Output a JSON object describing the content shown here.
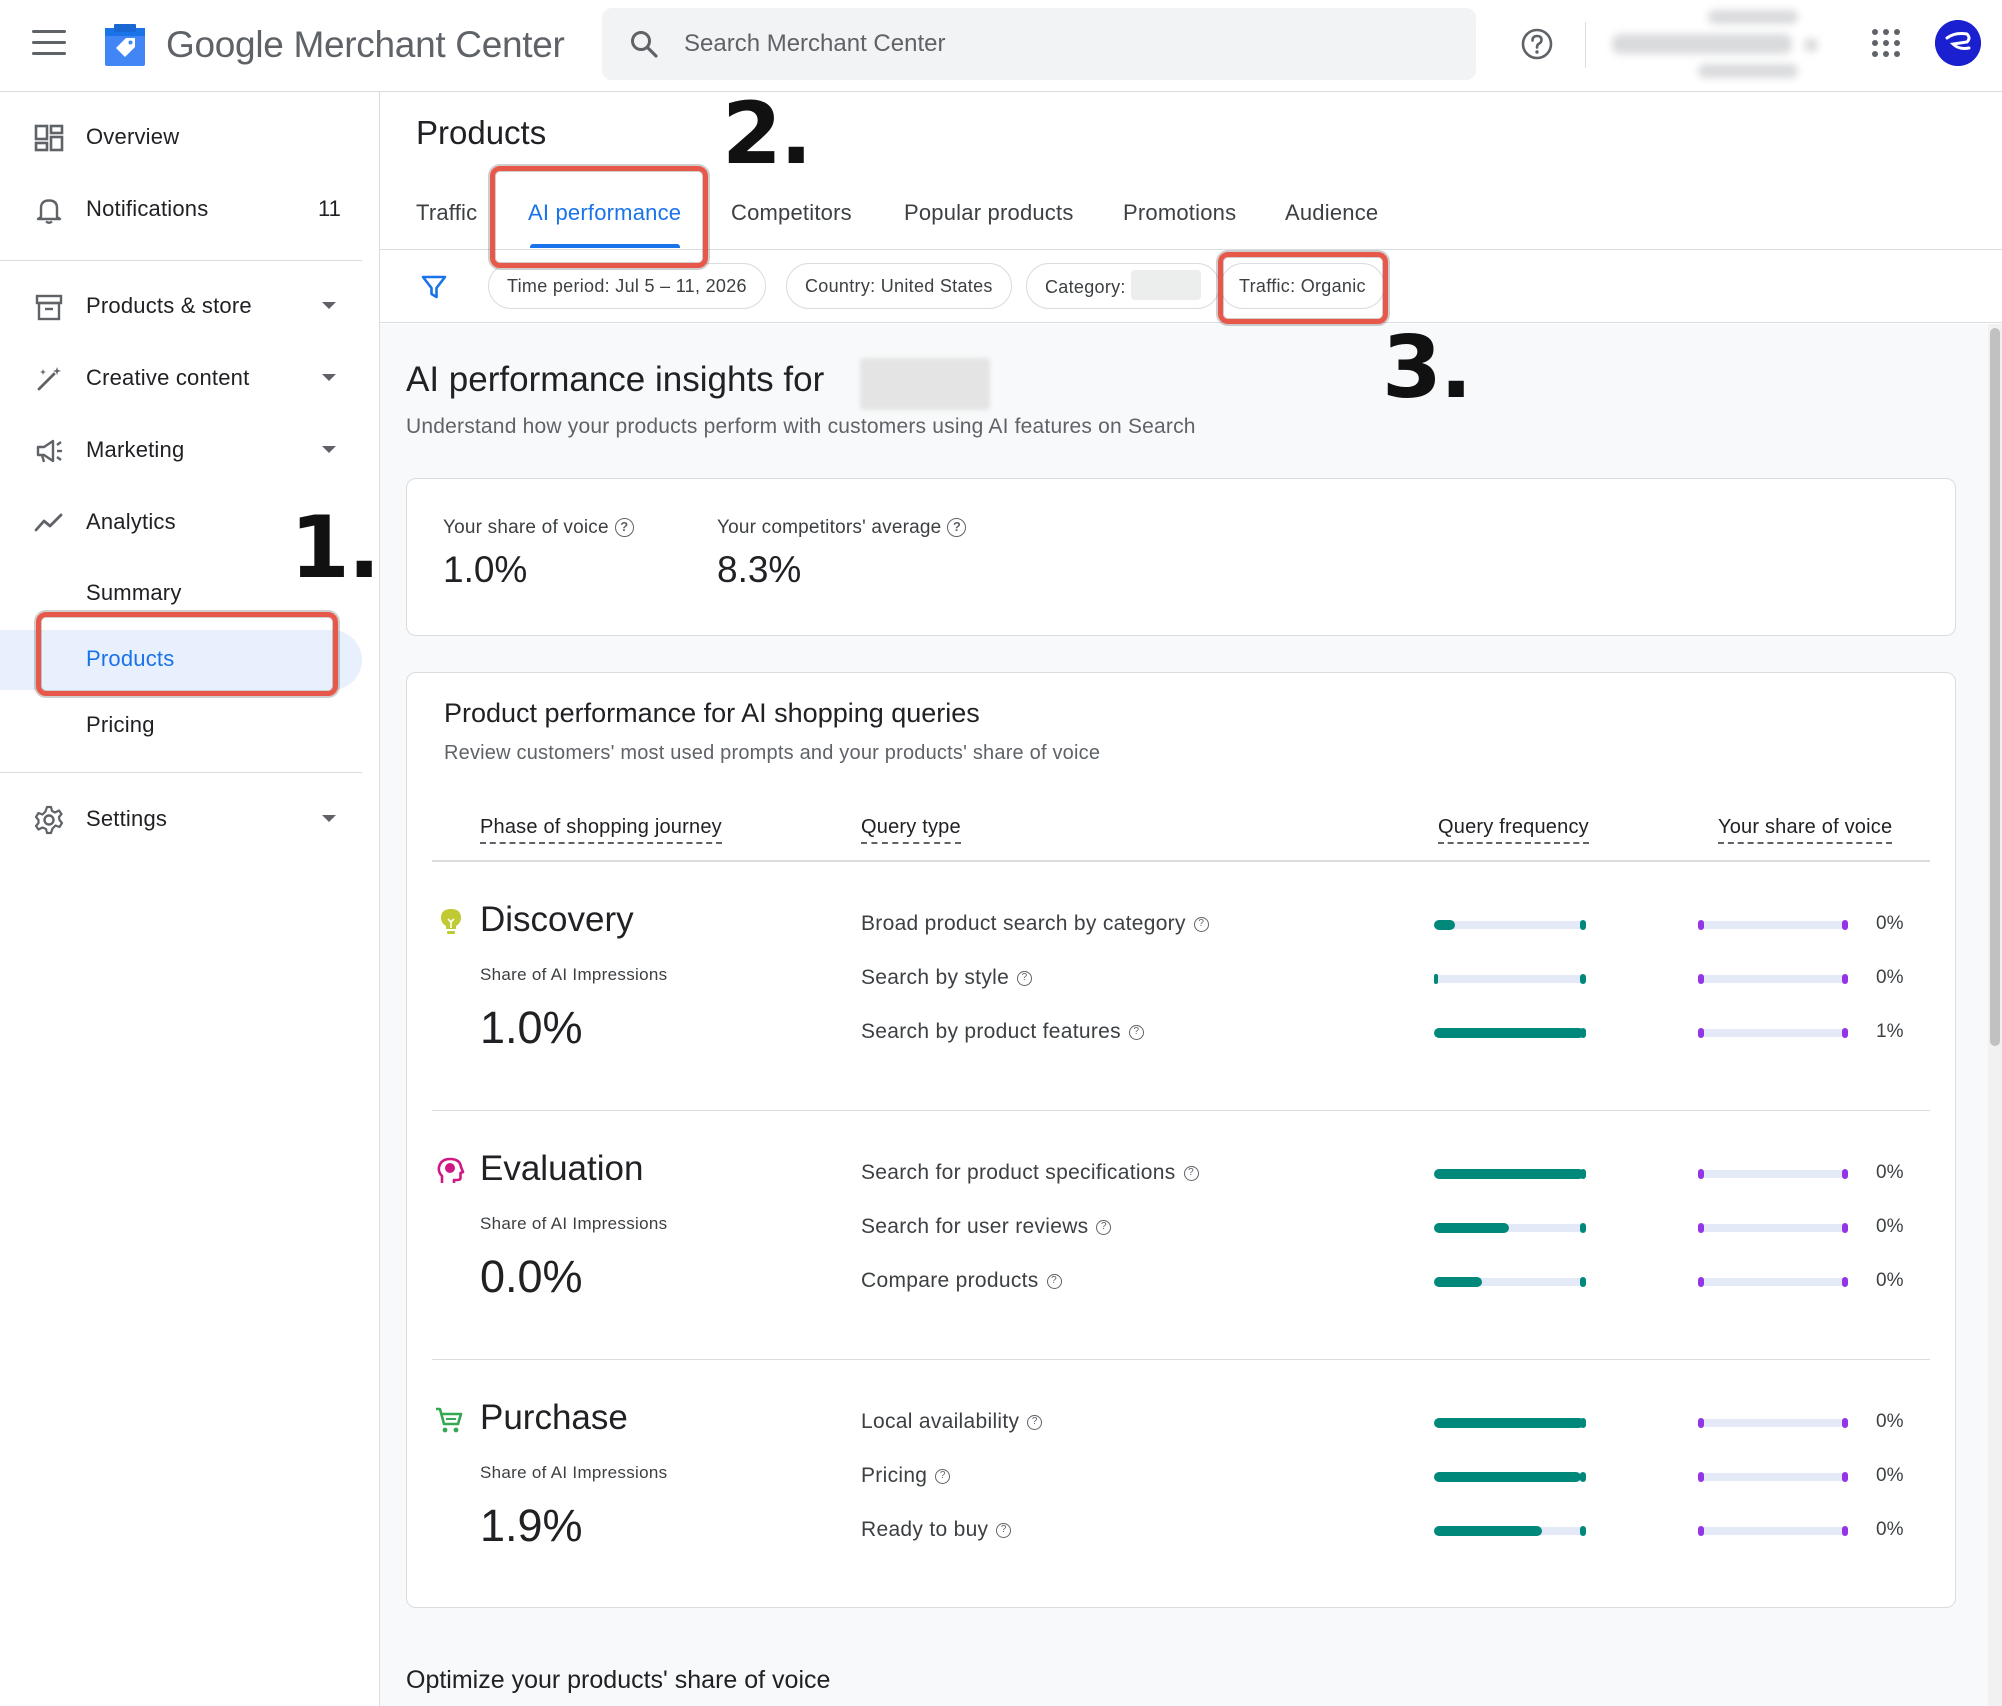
{
  "header": {
    "app_title": "Google Merchant Center",
    "search_placeholder": "Search Merchant Center"
  },
  "sidebar": {
    "overview": "Overview",
    "notifications": "Notifications",
    "notifications_count": "11",
    "products_store": "Products & store",
    "creative_content": "Creative content",
    "marketing": "Marketing",
    "analytics": "Analytics",
    "analytics_sub": [
      "Summary",
      "Products",
      "Pricing"
    ],
    "settings": "Settings"
  },
  "page": {
    "title": "Products",
    "tabs": [
      "Traffic",
      "AI performance",
      "Competitors",
      "Popular products",
      "Promotions",
      "Audience"
    ],
    "active_tab": "AI performance"
  },
  "filters": {
    "time_period": "Time period: Jul 5 – 11, 2026",
    "country": "Country: United States",
    "category": "Category:",
    "traffic": "Traffic: Organic"
  },
  "insights": {
    "title": "AI performance insights for",
    "subtitle": "Understand how your products perform with customers using AI features on Search",
    "share_of_voice_label": "Your share of voice",
    "share_of_voice_value": "1.0%",
    "competitors_label": "Your competitors' average",
    "competitors_value": "8.3%"
  },
  "performance": {
    "title": "Product performance for AI shopping queries",
    "subtitle": "Review customers' most used prompts and your products' share of voice",
    "columns": [
      "Phase of shopping journey",
      "Query type",
      "Query frequency",
      "Your share of voice"
    ],
    "impressions_label": "Share of AI Impressions",
    "phases": [
      {
        "name": "Discovery",
        "icon": "lightbulb-icon",
        "color": "#9bb50a",
        "share": "1.0%",
        "queries": [
          {
            "label": "Broad product search by category",
            "frequency": 0.14,
            "sov": "0%"
          },
          {
            "label": "Search by style",
            "frequency": 0.02,
            "sov": "0%"
          },
          {
            "label": "Search by product features",
            "frequency": 1.0,
            "sov": "1%"
          }
        ]
      },
      {
        "name": "Evaluation",
        "icon": "head-icon",
        "color": "#d01884",
        "share": "0.0%",
        "queries": [
          {
            "label": "Search for product specifications",
            "frequency": 1.0,
            "sov": "0%"
          },
          {
            "label": "Search for user reviews",
            "frequency": 0.5,
            "sov": "0%"
          },
          {
            "label": "Compare products",
            "frequency": 0.32,
            "sov": "0%"
          }
        ]
      },
      {
        "name": "Purchase",
        "icon": "cart-icon",
        "color": "#34a853",
        "share": "1.9%",
        "queries": [
          {
            "label": "Local availability",
            "frequency": 1.0,
            "sov": "0%"
          },
          {
            "label": "Pricing",
            "frequency": 0.98,
            "sov": "0%"
          },
          {
            "label": "Ready to buy",
            "frequency": 0.72,
            "sov": "0%"
          }
        ]
      }
    ]
  },
  "optimize_title": "Optimize your products' share of voice",
  "annotations": [
    "1.",
    "2.",
    "3."
  ],
  "colors": {
    "accent": "#1a73e8",
    "frequency_bar": "#00897b",
    "share_of_voice_dot": "#9334e6",
    "highlight": "#e8584a"
  }
}
